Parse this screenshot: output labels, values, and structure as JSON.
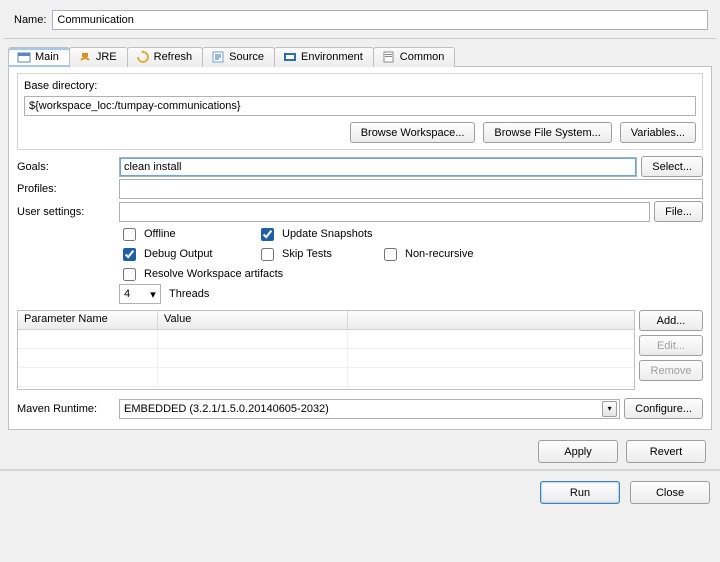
{
  "name": {
    "label": "Name:",
    "value": "Communication"
  },
  "tabs": [
    {
      "label": "Main"
    },
    {
      "label": "JRE"
    },
    {
      "label": "Refresh"
    },
    {
      "label": "Source"
    },
    {
      "label": "Environment"
    },
    {
      "label": "Common"
    }
  ],
  "basedir": {
    "label": "Base directory:",
    "value": "${workspace_loc:/tumpay-communications}",
    "browse_ws": "Browse Workspace...",
    "browse_fs": "Browse File System...",
    "variables": "Variables..."
  },
  "goals": {
    "label": "Goals:",
    "value": "clean install",
    "select": "Select..."
  },
  "profiles": {
    "label": "Profiles:",
    "value": ""
  },
  "usersettings": {
    "label": "User settings:",
    "value": "",
    "file": "File..."
  },
  "checks": {
    "offline": "Offline",
    "update": "Update Snapshots",
    "debug": "Debug Output",
    "skip": "Skip Tests",
    "nonrec": "Non-recursive",
    "resolve": "Resolve Workspace artifacts"
  },
  "threads": {
    "value": "4",
    "label": "Threads"
  },
  "table": {
    "cols": [
      "Parameter Name",
      "Value"
    ],
    "add": "Add...",
    "edit": "Edit...",
    "remove": "Remove"
  },
  "runtime": {
    "label": "Maven Runtime:",
    "value": "EMBEDDED (3.2.1/1.5.0.20140605-2032)",
    "configure": "Configure..."
  },
  "apply": "Apply",
  "revert": "Revert",
  "run": "Run",
  "close": "Close"
}
